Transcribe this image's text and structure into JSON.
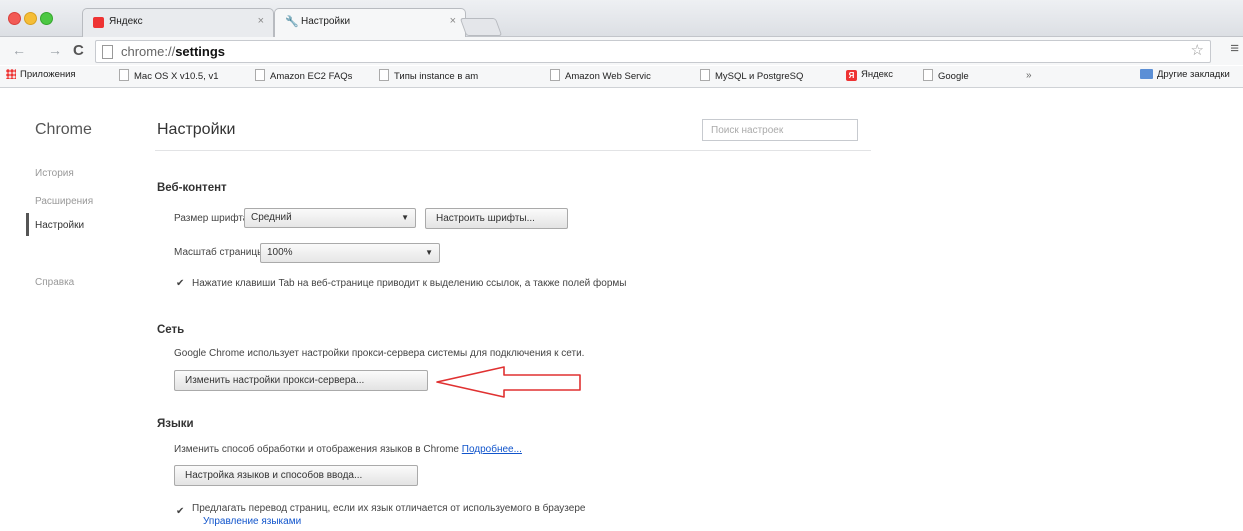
{
  "tabs": [
    {
      "title": "Яндекс",
      "close": "×"
    },
    {
      "title": "Настройки",
      "close": "×"
    }
  ],
  "toolbar": {
    "back": "←",
    "forward": "→",
    "reload": "C",
    "url_prefix": "chrome://",
    "url_path": "settings",
    "star": "☆",
    "menu": "≡"
  },
  "bookmarks": [
    "Приложения",
    "Mac OS X v10.5, v1",
    "Amazon EC2 FAQs",
    "Типы instance в am",
    "Amazon Web Servic",
    "MySQL и PostgreSQ",
    "Яндекс",
    "Google"
  ],
  "bookmarks_chevron": "»",
  "other_bookmarks": "Другие закладки",
  "sidebar": {
    "brand": "Chrome",
    "items": [
      "История",
      "Расширения",
      "Настройки",
      "Справка"
    ]
  },
  "header": {
    "title": "Настройки",
    "search_placeholder": "Поиск настроек"
  },
  "web_content": {
    "title": "Веб-контент",
    "font_size_label": "Размер шрифта:",
    "font_size_value": "Средний",
    "customize_fonts_button": "Настроить шрифты...",
    "page_zoom_label": "Масштаб страницы:",
    "page_zoom_value": "100%",
    "tab_highlight_label": "Нажатие клавиши Tab на веб-странице приводит к выделению ссылок, а также полей формы",
    "tab_highlight_checked": true
  },
  "network": {
    "title": "Сеть",
    "description": "Google Chrome использует настройки прокси-сервера системы для подключения к сети.",
    "proxy_button": "Изменить настройки прокси-сервера..."
  },
  "languages": {
    "title": "Языки",
    "description": "Изменить способ обработки и отображения языков в Chrome",
    "more_link": "Подробнее...",
    "language_button": "Настройка языков и способов ввода...",
    "translate_label": "Предлагать перевод страниц, если их язык отличается от используемого в браузере",
    "translate_checked": true,
    "manage_link": "Управление языками"
  },
  "colors": {
    "annotation_arrow": "#e03131",
    "link": "#1155cc"
  }
}
